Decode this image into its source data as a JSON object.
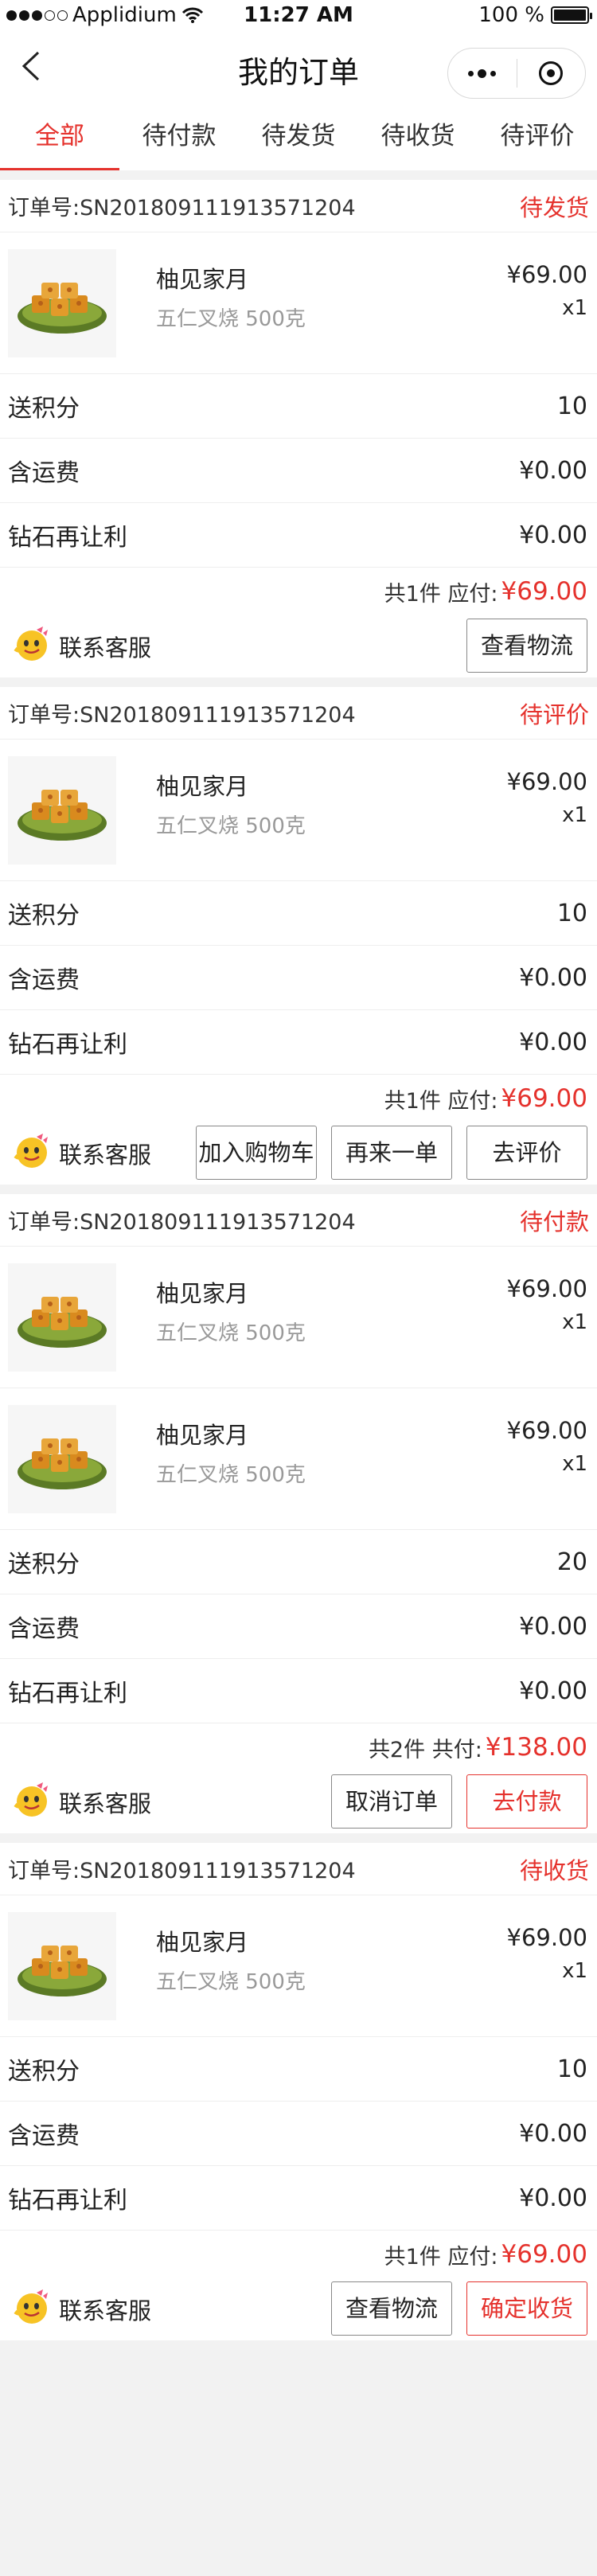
{
  "status_bar": {
    "carrier": "Applidium",
    "time": "11:27 AM",
    "battery": "100 %"
  },
  "nav": {
    "title": "我的订单"
  },
  "tabs": [
    {
      "label": "全部",
      "active": true
    },
    {
      "label": "待付款",
      "active": false
    },
    {
      "label": "待发货",
      "active": false
    },
    {
      "label": "待收货",
      "active": false
    },
    {
      "label": "待评价",
      "active": false
    }
  ],
  "labels": {
    "points": "送积分",
    "shipping": "含运费",
    "diamond": "钻石再让利",
    "service": "联系客服"
  },
  "orders": [
    {
      "order_no": "订单号:SN201809111913571204",
      "status": "待发货",
      "products": [
        {
          "name": "柚见家月",
          "spec": "五仁叉烧 500克",
          "price": "¥69.00",
          "qty": "x1"
        }
      ],
      "points": "10",
      "shipping": "¥0.00",
      "diamond": "¥0.00",
      "total_label": "共1件 应付:",
      "total_amount": "¥69.00",
      "buttons": [
        {
          "label": "查看物流",
          "style": "normal"
        }
      ]
    },
    {
      "order_no": "订单号:SN201809111913571204",
      "status": "待评价",
      "products": [
        {
          "name": "柚见家月",
          "spec": "五仁叉烧 500克",
          "price": "¥69.00",
          "qty": "x1"
        }
      ],
      "points": "10",
      "shipping": "¥0.00",
      "diamond": "¥0.00",
      "total_label": "共1件 应付:",
      "total_amount": "¥69.00",
      "buttons": [
        {
          "label": "加入购物车",
          "style": "normal"
        },
        {
          "label": "再来一单",
          "style": "normal"
        },
        {
          "label": "去评价",
          "style": "normal"
        }
      ]
    },
    {
      "order_no": "订单号:SN201809111913571204",
      "status": "待付款",
      "products": [
        {
          "name": "柚见家月",
          "spec": "五仁叉烧 500克",
          "price": "¥69.00",
          "qty": "x1"
        },
        {
          "name": "柚见家月",
          "spec": "五仁叉烧 500克",
          "price": "¥69.00",
          "qty": "x1"
        }
      ],
      "points": "20",
      "shipping": "¥0.00",
      "diamond": "¥0.00",
      "total_label": "共2件 共付:",
      "total_amount": "¥138.00",
      "buttons": [
        {
          "label": "取消订单",
          "style": "normal"
        },
        {
          "label": "去付款",
          "style": "red"
        }
      ]
    },
    {
      "order_no": "订单号:SN201809111913571204",
      "status": "待收货",
      "products": [
        {
          "name": "柚见家月",
          "spec": "五仁叉烧 500克",
          "price": "¥69.00",
          "qty": "x1"
        }
      ],
      "points": "10",
      "shipping": "¥0.00",
      "diamond": "¥0.00",
      "total_label": "共1件 应付:",
      "total_amount": "¥69.00",
      "buttons": [
        {
          "label": "查看物流",
          "style": "normal"
        },
        {
          "label": "确定收货",
          "style": "red"
        }
      ]
    }
  ]
}
